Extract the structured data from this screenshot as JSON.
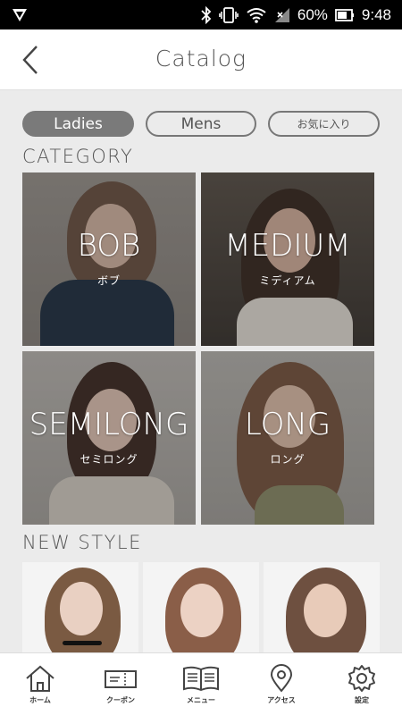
{
  "status_bar": {
    "battery_percent": "60%",
    "time": "9:48"
  },
  "header": {
    "title": "Catalog"
  },
  "tabs": [
    {
      "label": "Ladies",
      "active": true
    },
    {
      "label": "Mens",
      "active": false
    },
    {
      "label": "お気に入り",
      "active": false
    }
  ],
  "category": {
    "heading": "CATEGORY",
    "items": [
      {
        "en": "BOB",
        "ja": "ボブ"
      },
      {
        "en": "MEDIUM",
        "ja": "ミディアム"
      },
      {
        "en": "SEMILONG",
        "ja": "セミロング"
      },
      {
        "en": "LONG",
        "ja": "ロング"
      }
    ]
  },
  "new_style": {
    "heading": "NEW STYLE"
  },
  "bottom_nav": [
    {
      "label": "ホーム",
      "icon": "home-icon"
    },
    {
      "label": "クーポン",
      "icon": "coupon-icon"
    },
    {
      "label": "メニュー",
      "icon": "menu-book-icon"
    },
    {
      "label": "アクセス",
      "icon": "map-pin-icon"
    },
    {
      "label": "設定",
      "icon": "gear-icon"
    }
  ]
}
